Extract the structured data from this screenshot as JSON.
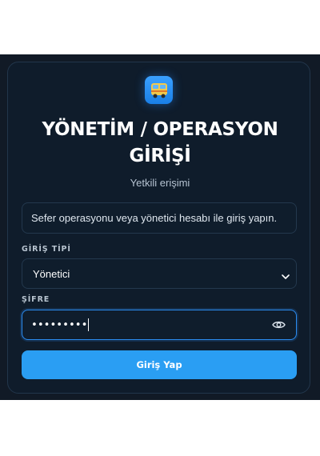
{
  "header": {
    "logo_icon": "bus-icon",
    "title_line1": "YÖNETİM / OPERASYON",
    "title_line2": "GİRİŞİ",
    "subtitle": "Yetkili erişimi"
  },
  "info_text": "Sefer operasyonu veya yönetici hesabı ile giriş yapın.",
  "form": {
    "type_label": "GİRİŞ TİPİ",
    "type_value": "Yönetici",
    "password_label": "ŞİFRE",
    "password_value": "•••••••••",
    "submit_label": "Giriş Yap"
  },
  "colors": {
    "background": "#111a26",
    "card": "#0f1c2b",
    "accent": "#2a9ef3"
  }
}
